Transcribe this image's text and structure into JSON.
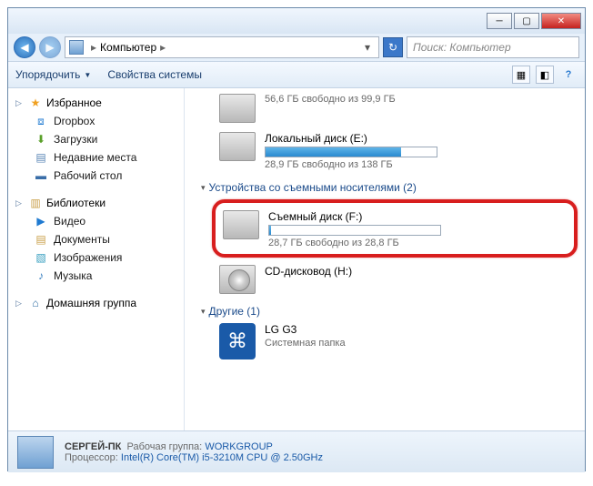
{
  "breadcrumb": {
    "location": "Компьютер"
  },
  "search": {
    "placeholder": "Поиск: Компьютер"
  },
  "toolbar": {
    "organize": "Упорядочить",
    "properties": "Свойства системы"
  },
  "sidebar": {
    "favorites": {
      "header": "Избранное",
      "items": [
        "Dropbox",
        "Загрузки",
        "Недавние места",
        "Рабочий стол"
      ]
    },
    "libraries": {
      "header": "Библиотеки",
      "items": [
        "Видео",
        "Документы",
        "Изображения",
        "Музыка"
      ]
    },
    "homegroup": {
      "header": "Домашняя группа"
    }
  },
  "drives": {
    "c_free": "56,6 ГБ свободно из 99,9 ГБ",
    "e_name": "Локальный диск (E:)",
    "e_free": "28,9 ГБ свободно из 138 ГБ",
    "removable_header": "Устройства со съемными носителями (2)",
    "f_name": "Съемный диск (F:)",
    "f_free": "28,7 ГБ свободно из 28,8 ГБ",
    "cd_name": "CD-дисковод (H:)",
    "other_header": "Другие (1)",
    "bt_name": "LG G3",
    "bt_sub": "Системная папка"
  },
  "status": {
    "pc_name": "СЕРГЕЙ-ПК",
    "workgroup_label": "Рабочая группа:",
    "workgroup": "WORKGROUP",
    "cpu_label": "Процессор:",
    "cpu": "Intel(R) Core(TM) i5-3210M CPU @ 2.50GHz"
  }
}
